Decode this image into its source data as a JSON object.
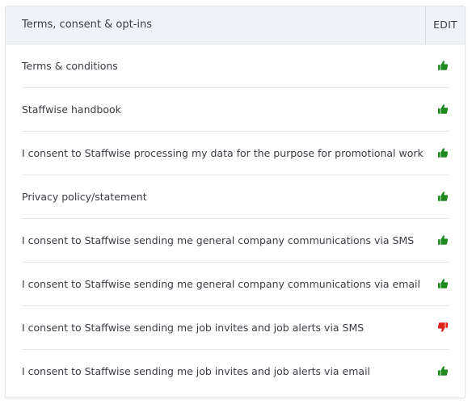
{
  "header": {
    "title": "Terms, consent & opt-ins",
    "edit_label": "EDIT"
  },
  "colors": {
    "accepted": "#1c8a1f",
    "declined": "#e0221c"
  },
  "items": [
    {
      "label": "Terms & conditions",
      "status": "accepted",
      "icon": "thumbs-up-icon"
    },
    {
      "label": "Staffwise handbook",
      "status": "accepted",
      "icon": "thumbs-up-icon"
    },
    {
      "label": "I consent to Staffwise processing my data for the purpose for promotional work",
      "status": "accepted",
      "icon": "thumbs-up-icon"
    },
    {
      "label": "Privacy policy/statement",
      "status": "accepted",
      "icon": "thumbs-up-icon"
    },
    {
      "label": "I consent to Staffwise sending me general company communications via SMS",
      "status": "accepted",
      "icon": "thumbs-up-icon"
    },
    {
      "label": "I consent to Staffwise sending me general company communications via email",
      "status": "accepted",
      "icon": "thumbs-up-icon"
    },
    {
      "label": "I consent to Staffwise sending me job invites and job alerts via SMS",
      "status": "declined",
      "icon": "thumbs-down-icon"
    },
    {
      "label": "I consent to Staffwise sending me job invites and job alerts via email",
      "status": "accepted",
      "icon": "thumbs-up-icon"
    }
  ]
}
